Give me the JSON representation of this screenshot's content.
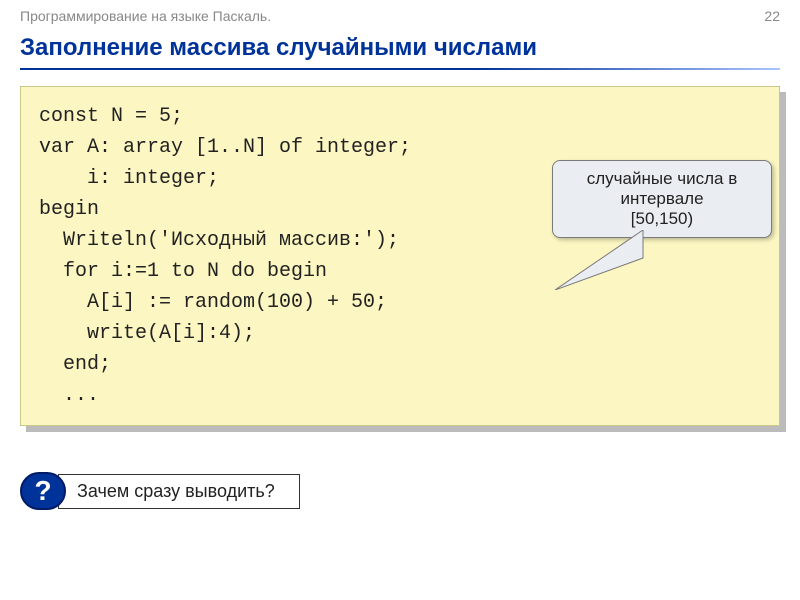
{
  "header": {
    "course": "Программирование на языке Паскаль.",
    "page_number": "22"
  },
  "title": "Заполнение массива случайными числами",
  "code": {
    "lines": [
      "const N = 5;",
      "var A: array [1..N] of integer;",
      "    i: integer;",
      "begin",
      "  Writeln('Исходный массив:');",
      "  for i:=1 to N do begin",
      "    A[i] := random(100) + 50;",
      "    write(A[i]:4);",
      "  end;",
      "  ..."
    ]
  },
  "callout": {
    "line1": "случайные числа в",
    "line2": "интервале",
    "line3": "[50,150)"
  },
  "question": {
    "mark": "?",
    "text": "Зачем сразу выводить?"
  }
}
